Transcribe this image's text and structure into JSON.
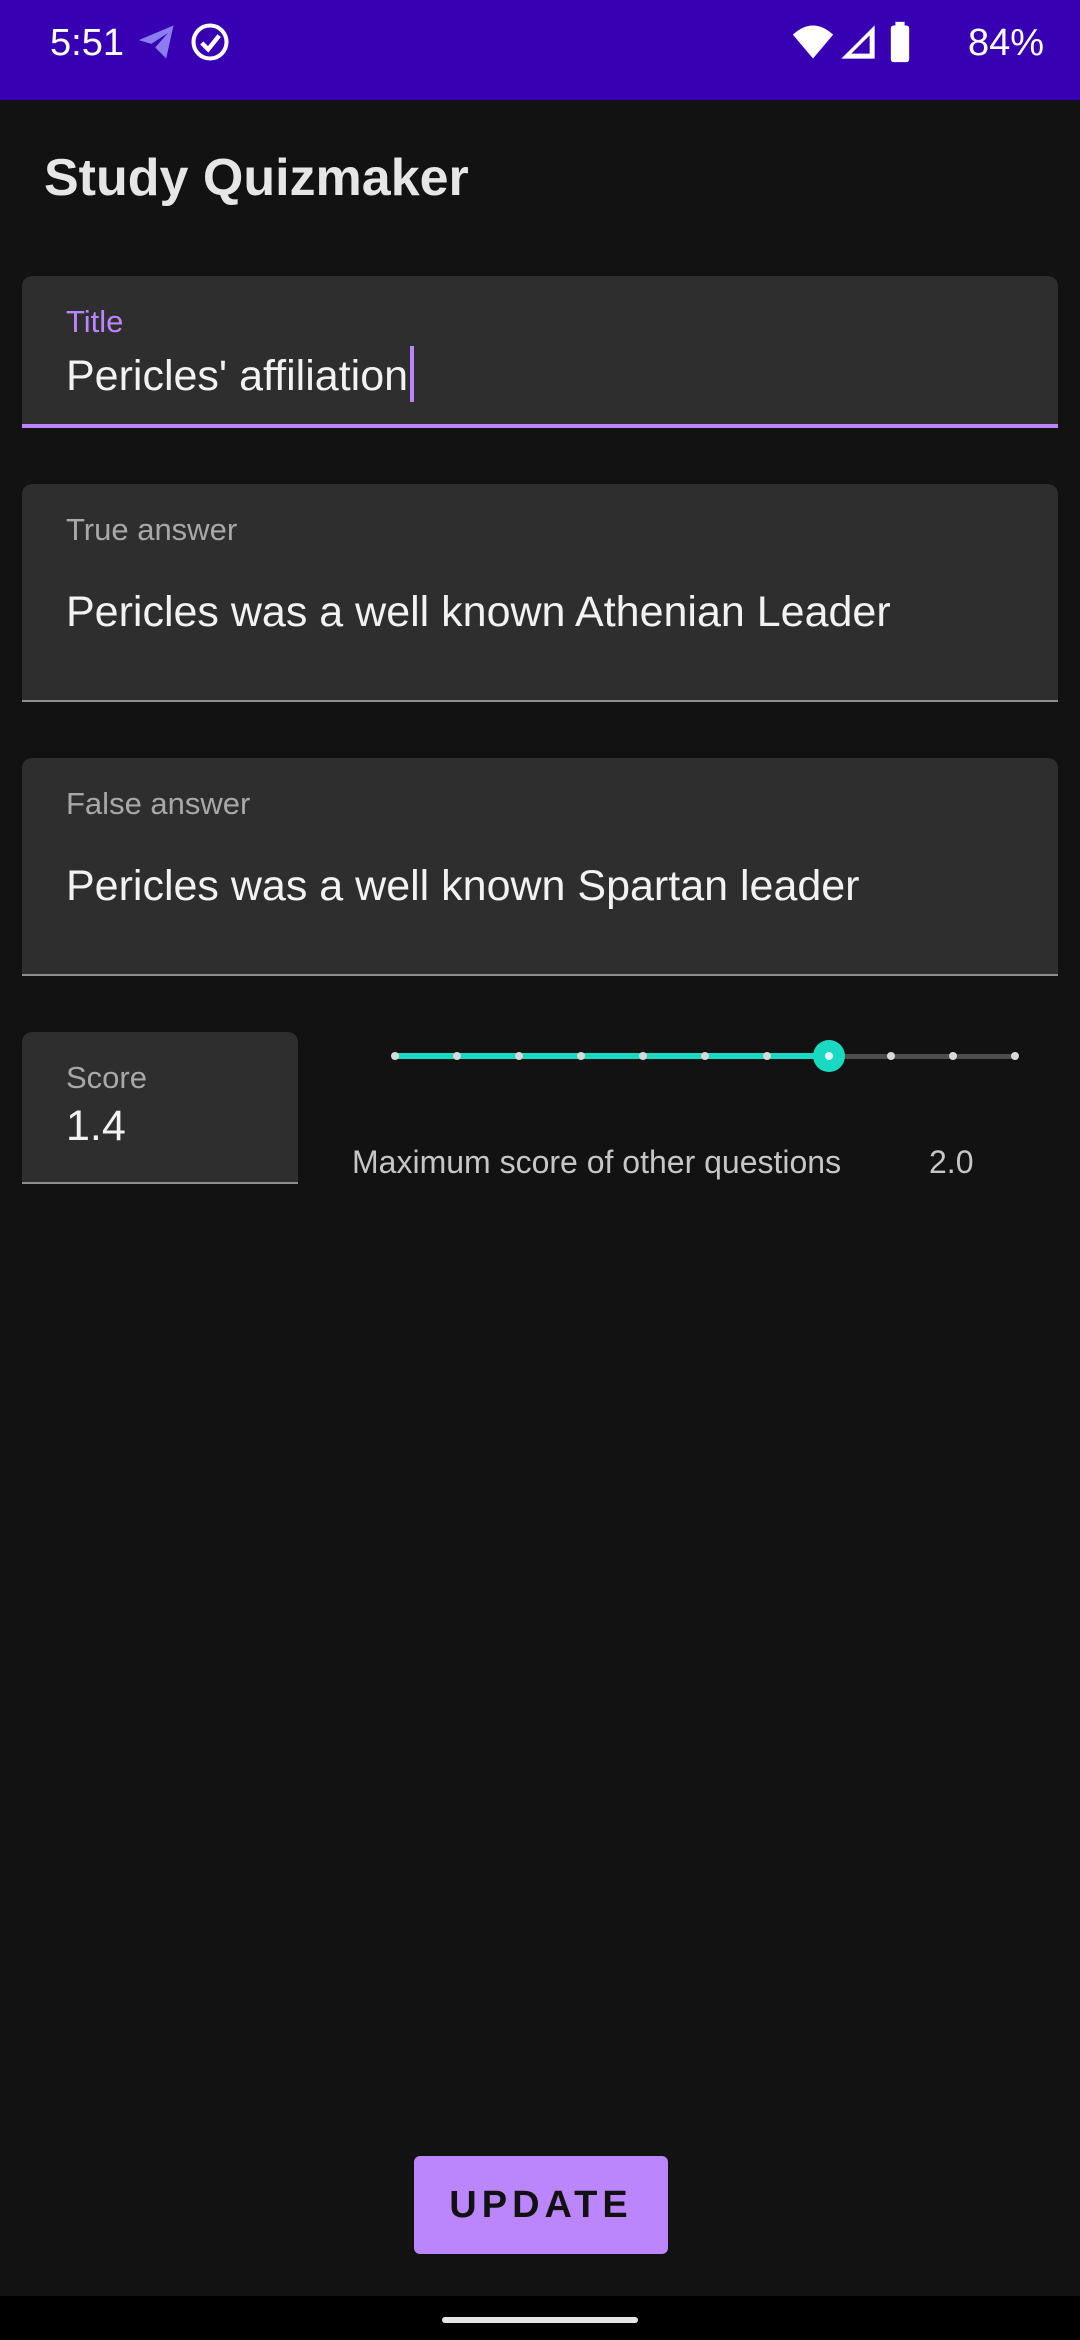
{
  "status_bar": {
    "time": "5:51",
    "battery": "84%",
    "icons": [
      "telegram-icon",
      "check-circle-icon",
      "wifi-icon",
      "signal-icon",
      "battery-icon"
    ]
  },
  "app": {
    "title": "Study Quizmaker"
  },
  "form": {
    "title_field": {
      "label": "Title",
      "value": "Pericles' affiliation"
    },
    "true_answer_field": {
      "label": "True answer",
      "value": "Pericles was a well known Athenian Leader"
    },
    "false_answer_field": {
      "label": "False answer",
      "value": "Pericles was a well known Spartan leader"
    },
    "score_field": {
      "label": "Score",
      "value": "1.4"
    }
  },
  "slider": {
    "caption": "Maximum score of other questions",
    "max_label": "2.0",
    "min": 0,
    "max": 2.0,
    "step": 0.2,
    "value": 1.4
  },
  "actions": {
    "update_label": "UPDATE"
  },
  "colors": {
    "status_bar": "#3700b3",
    "accent": "#bb86fc",
    "slider_active": "#1ad9c1",
    "background": "#121212"
  }
}
